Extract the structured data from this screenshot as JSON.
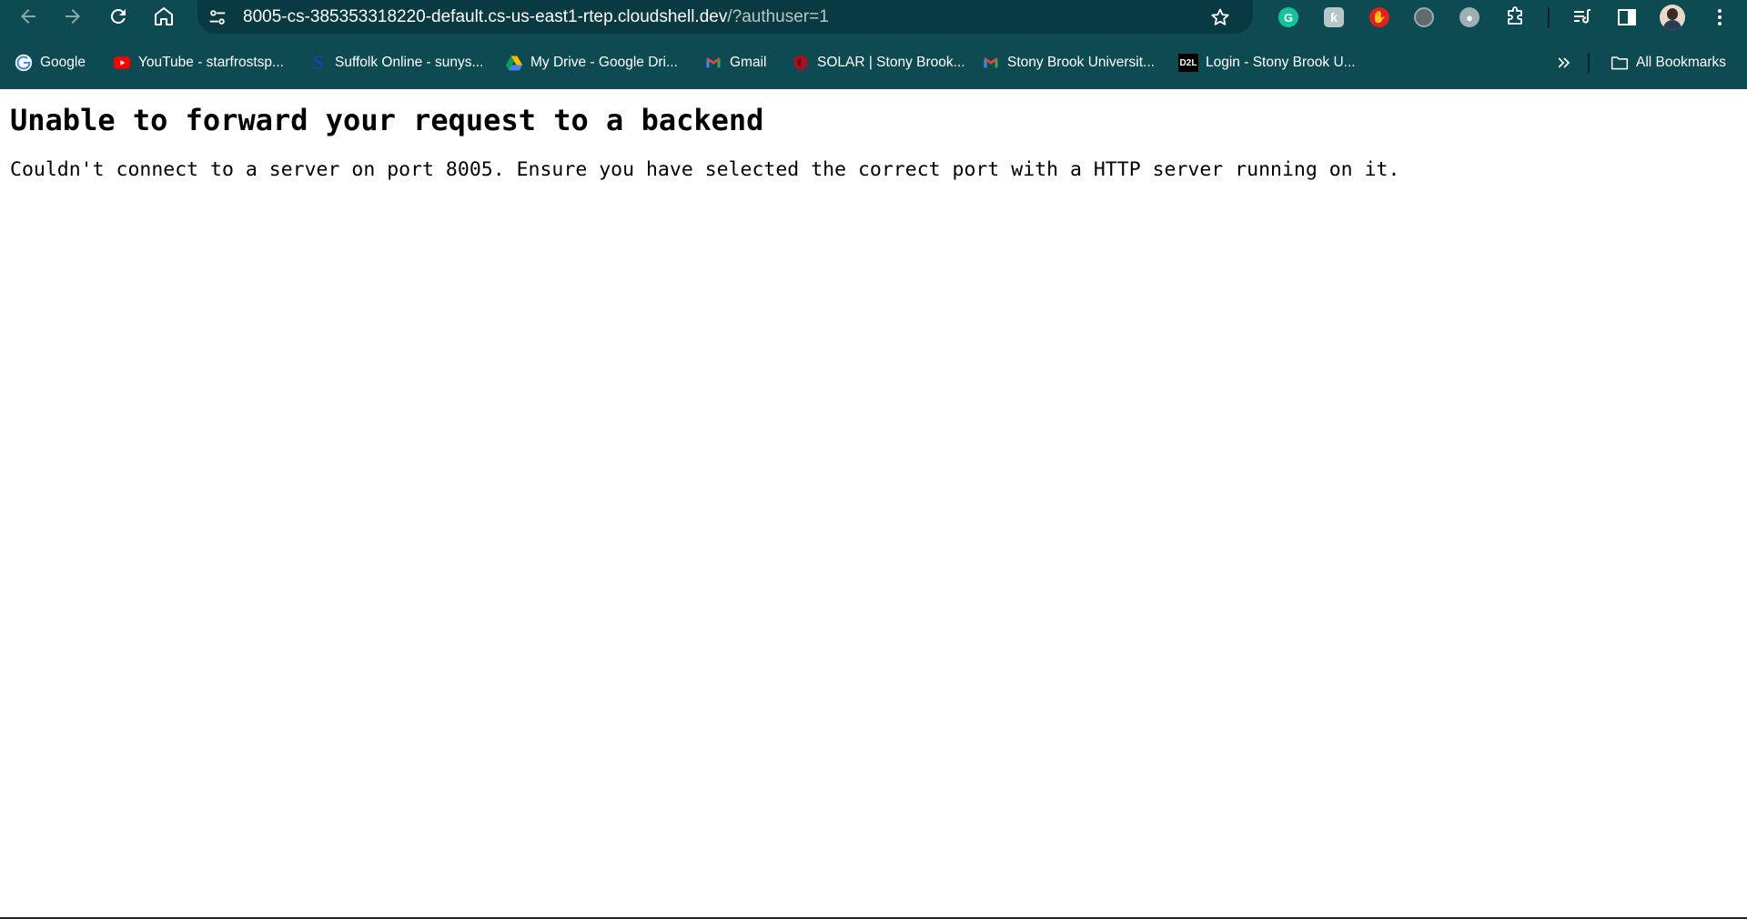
{
  "browser": {
    "url": {
      "host": "8005-cs-385353318220-default.cs-us-east1-rtep.cloudshell.dev",
      "rest": "/?authuser=1"
    },
    "colors": {
      "frame": "#0e4a52",
      "omnibox": "#0a3a41"
    },
    "toolbar_icons": [
      "back-icon",
      "forward-icon",
      "reload-icon",
      "home-icon",
      "site-info-icon",
      "star-icon"
    ],
    "extensions": [
      "grammarly-icon",
      "extension-k-icon",
      "stop-hand-icon",
      "extension-shield-icon",
      "extension-pin-icon",
      "puzzle-icon",
      "reading-list-icon",
      "side-panel-icon",
      "profile-avatar",
      "menu-icon"
    ]
  },
  "bookmarks": {
    "items": [
      {
        "label": "Google",
        "icon": "google-icon"
      },
      {
        "label": "YouTube - starfrostsp...",
        "icon": "youtube-icon"
      },
      {
        "label": "Suffolk Online - sunys...",
        "icon": "suffolk-icon"
      },
      {
        "label": "My Drive - Google Dri...",
        "icon": "drive-icon"
      },
      {
        "label": "Gmail",
        "icon": "gmail-icon"
      },
      {
        "label": "SOLAR | Stony Brook...",
        "icon": "solar-shield-icon"
      },
      {
        "label": "Stony Brook Universit...",
        "icon": "gmail-icon"
      },
      {
        "label": "Login - Stony Brook U...",
        "icon": "d2l-icon"
      }
    ],
    "d2l_label": "D2L",
    "all_bookmarks": "All Bookmarks"
  },
  "page": {
    "heading": "Unable to forward your request to a backend",
    "message": "Couldn't connect to a server on port 8005. Ensure you have selected the correct port with a HTTP server running on it."
  }
}
